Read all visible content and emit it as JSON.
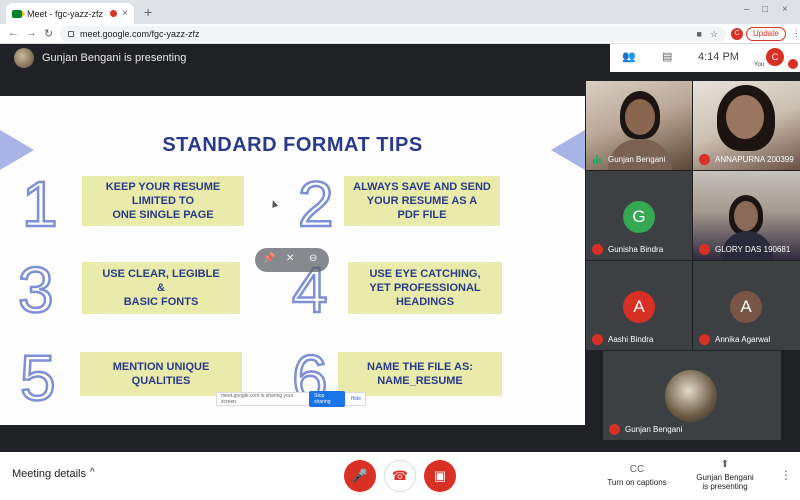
{
  "browser": {
    "tab_title": "Meet - fgc-yazz-zfz",
    "tab_close": "×",
    "new_tab": "+",
    "url": "meet.google.com/fgc-yazz-zfz",
    "profile_initial": "C",
    "update_label": "Update",
    "window_min": "–",
    "window_max": "□",
    "window_close": "×",
    "back": "←",
    "forward": "→",
    "reload": "↻",
    "kebab": "⋮"
  },
  "meet": {
    "presenter_text": "Gunjan Bengani is presenting",
    "time": "4:14 PM",
    "participant_count_icon": "people-icon",
    "chat_icon": "chat-icon",
    "self_initial": "C",
    "you_label": "You"
  },
  "slide": {
    "title": "STANDARD FORMAT TIPS",
    "tips": [
      {
        "num": "1",
        "text": "KEEP YOUR RESUME\nLIMITED TO\nONE SINGLE PAGE"
      },
      {
        "num": "2",
        "text": "ALWAYS SAVE AND SEND\nYOUR RESUME AS A\nPDF FILE"
      },
      {
        "num": "3",
        "text": "USE CLEAR, LEGIBLE\n&\nBASIC FONTS"
      },
      {
        "num": "4",
        "text": "USE EYE CATCHING,\nYET PROFESSIONAL\nHEADINGS"
      },
      {
        "num": "5",
        "text": "MENTION UNIQUE\nQUALITIES"
      },
      {
        "num": "6",
        "text": "NAME THE FILE AS:\nNAME_RESUME"
      }
    ],
    "share_banner_text": "meet.google.com is sharing your screen.",
    "stop_sharing": "Stop sharing",
    "hide": "Hide"
  },
  "participants": [
    {
      "name": "Gunjan Bengani",
      "type": "video",
      "speaking": true
    },
    {
      "name": "ANNAPURNA 200399",
      "type": "video",
      "muted": true
    },
    {
      "name": "Gunisha Bindra",
      "type": "avatar",
      "initial": "G",
      "color": "#34a853",
      "muted": true
    },
    {
      "name": "GLORY DAS 190681",
      "type": "video",
      "muted": true
    },
    {
      "name": "Aashi Bindra",
      "type": "avatar",
      "initial": "A",
      "color": "#d93025",
      "muted": true
    },
    {
      "name": "Annika Agarwal",
      "type": "avatar",
      "initial": "A",
      "color": "#795548",
      "muted": true
    },
    {
      "name": "Gunjan Bengani",
      "type": "self-share",
      "muted": true
    }
  ],
  "bottombar": {
    "meeting_details": "Meeting details",
    "chevron": "^",
    "captions_label": "Turn on captions",
    "captions_icon": "CC",
    "presenting_label_1": "Gunjan Bengani",
    "presenting_label_2": "is presenting",
    "more": "⋮"
  },
  "colors": {
    "leave_red": "#d93025",
    "slide_title": "#2a3a8a",
    "tip_box": "#e9ebaa",
    "numeral_outline": "#7e8fd4"
  }
}
